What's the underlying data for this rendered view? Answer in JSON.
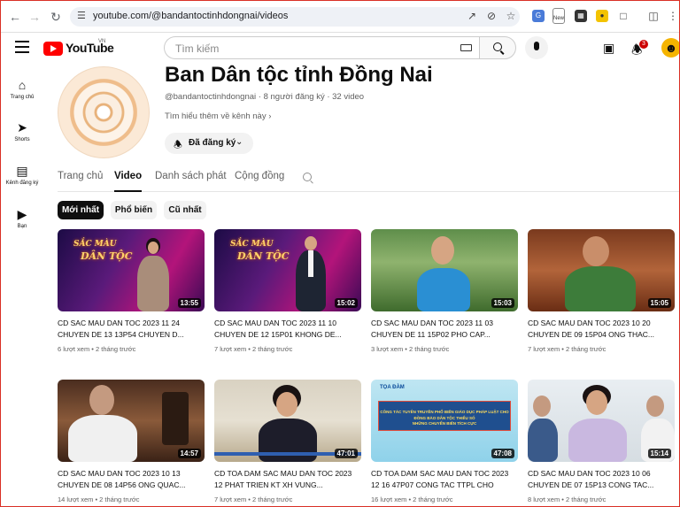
{
  "browser": {
    "url": "youtube.com/@bandantoctinhdongnai/videos",
    "ext_new_label": "New"
  },
  "header": {
    "logo_text": "YouTube",
    "region": "VN",
    "search_placeholder": "Tìm kiếm",
    "notification_count": "3"
  },
  "left_nav": [
    {
      "label": "Trang chủ",
      "icon": "home-icon"
    },
    {
      "label": "Shorts",
      "icon": "shorts-icon"
    },
    {
      "label": "Kênh đăng ký",
      "icon": "subscriptions-icon"
    },
    {
      "label": "Bạn",
      "icon": "you-icon"
    }
  ],
  "channel": {
    "name": "Ban Dân tộc tỉnh Đồng Nai",
    "meta": "@bandantoctinhdongnai · 8 người đăng ký · 32 video",
    "more_link": "Tìm hiểu thêm về kênh này",
    "subscribed_label": "Đã đăng ký"
  },
  "tabs": [
    "Trang chủ",
    "Video",
    "Danh sách phát",
    "Cộng đồng"
  ],
  "chips": [
    "Mới nhất",
    "Phổ biến",
    "Cũ nhất"
  ],
  "overlay_line1": "SẮC MÀU",
  "overlay_line2": "DÂN TỘC",
  "videos": [
    {
      "title": "CD SAC MAU DAN TOC 2023 11 24 CHUYEN DE 13 13P54 CHUYEN D...",
      "views": "6 lượt xem",
      "age": "2 tháng trước",
      "duration": "13:55"
    },
    {
      "title": "CD SAC MAU DAN TOC 2023 11 10 CHUYEN DE 12 15P01 KHONG DE...",
      "views": "7 lượt xem",
      "age": "2 tháng trước",
      "duration": "15:02"
    },
    {
      "title": "CD SAC MAU DAN TOC 2023 11 03 CHUYEN DE 11 15P02 PHO CAP...",
      "views": "3 lượt xem",
      "age": "2 tháng trước",
      "duration": "15:03"
    },
    {
      "title": "CD SAC MAU DAN TOC 2023 10 20 CHUYEN DE 09 15P04 ONG THAC...",
      "views": "7 lượt xem",
      "age": "2 tháng trước",
      "duration": "15:05"
    },
    {
      "title": "CD SAC MAU DAN TOC 2023 10 13 CHUYEN DE 08 14P56 ONG QUAC...",
      "views": "14 lượt xem",
      "age": "2 tháng trước",
      "duration": "14:57"
    },
    {
      "title": "CD TOA DAM SAC MAU DAN TOC 2023 12 PHAT TRIEN KT XH VUNG...",
      "views": "7 lượt xem",
      "age": "2 tháng trước",
      "duration": "47:01"
    },
    {
      "title": "CD TOA DAM SAC MAU DAN TOC 2023 12 16 47P07 CONG TAC TTPL CHO DON...",
      "views": "16 lượt xem",
      "age": "2 tháng trước",
      "duration": "47:08"
    },
    {
      "title": "CD SAC MAU DAN TOC 2023 10 06 CHUYEN DE 07 15P13 CONG TAC...",
      "views": "8 lượt xem",
      "age": "2 tháng trước",
      "duration": "15:14"
    }
  ],
  "thumb7": {
    "tag": "TỌA ĐÀM",
    "line1": "CÔNG TÁC TUYÊN TRUYỀN PHỔ BIẾN GIÁO DỤC PHÁP LUẬT CHO ĐỒNG BÀO DÂN TỘC THIỂU SỐ",
    "line2": "NHỮNG CHUYỂN BIẾN TÍCH CỰC"
  }
}
